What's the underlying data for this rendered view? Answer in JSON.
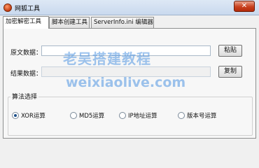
{
  "window": {
    "title": "网狐工具",
    "close_glyph": "✕",
    "icon": "fox-app-icon"
  },
  "tabs": [
    {
      "label": "加密解密工具",
      "active": true
    },
    {
      "label": "脚本创建工具",
      "active": false
    },
    {
      "label": "ServerInfo.ini 编辑器",
      "active": false
    }
  ],
  "form": {
    "source_label": "原文数据：",
    "source_value": "",
    "paste_button": "粘贴",
    "result_label": "结果数据：",
    "result_value": "",
    "copy_button": "复制"
  },
  "algorithm": {
    "group_label": "算法选择",
    "options": [
      {
        "label": "XOR运算",
        "selected": true
      },
      {
        "label": "MD5运算",
        "selected": false
      },
      {
        "label": "IP地址运算",
        "selected": false
      },
      {
        "label": "版本号运算",
        "selected": false
      }
    ]
  },
  "watermark": {
    "line1": "老吴搭建教程",
    "line2": "weixiaolive.com"
  },
  "colors": {
    "titlebar": "#c9d9ee",
    "close_button": "#c8401e",
    "selected_radio": "#1c4f8a",
    "watermark": "#5096e1"
  }
}
